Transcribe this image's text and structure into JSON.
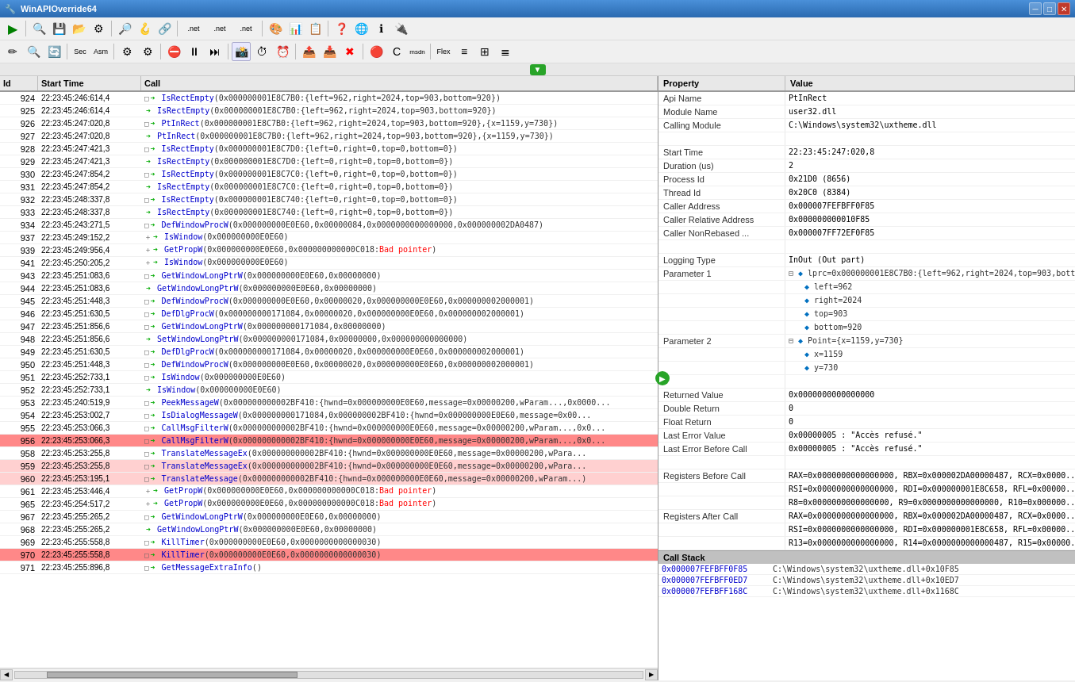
{
  "titleBar": {
    "title": "WinAPIOverride64",
    "minimize": "─",
    "maximize": "□",
    "close": "✕"
  },
  "header": {
    "property": "Property",
    "value": "Value"
  },
  "properties": {
    "apiName": {
      "label": "Api Name",
      "value": "PtInRect"
    },
    "moduleName": {
      "label": "Module Name",
      "value": "user32.dll"
    },
    "callingModule": {
      "label": "Calling Module",
      "value": "C:\\Windows\\system32\\uxtheme.dll"
    },
    "startTime": {
      "label": "Start Time",
      "value": "22:23:45:247:020,8"
    },
    "duration": {
      "label": "Duration (us)",
      "value": "2"
    },
    "processId": {
      "label": "Process Id",
      "value": "0x21D0 (8656)"
    },
    "threadId": {
      "label": "Thread Id",
      "value": "0x20C0 (8384)"
    },
    "callerAddress": {
      "label": "Caller Address",
      "value": "0x000007FEFBFF0F85"
    },
    "callerRelativeAddress": {
      "label": "Caller Relative Address",
      "value": "0x000000000010F85"
    },
    "callerNonRebased": {
      "label": "Caller NonRebased ...",
      "value": "0x000007FF72EF0F85"
    },
    "loggingType": {
      "label": "Logging Type",
      "value": "InOut (Out part)"
    },
    "parameter1": {
      "label": "Parameter 1"
    },
    "parameter1Value": "lprc=0x000000001E8C7B0:{left=962,right=2024,top=903,bott...",
    "param1Children": [
      {
        "label": "left=962"
      },
      {
        "label": "right=2024"
      },
      {
        "label": "top=903"
      },
      {
        "label": "bottom=920"
      }
    ],
    "parameter2": {
      "label": "Parameter 2"
    },
    "parameter2Value": "Point={x=1159,y=730}",
    "param2Children": [
      {
        "label": "x=1159"
      },
      {
        "label": "y=730"
      }
    ],
    "returnedValue": {
      "label": "Returned Value",
      "value": "0x0000000000000000"
    },
    "doubleReturn": {
      "label": "Double Return",
      "value": "0"
    },
    "floatReturn": {
      "label": "Float Return",
      "value": "0"
    },
    "lastErrorValue": {
      "label": "Last Error Value",
      "value": "0x00000005 : \"Accès refusé.\""
    },
    "lastErrorBeforeCall": {
      "label": "Last Error Before Call",
      "value": "0x00000005 : \"Accès refusé.\""
    },
    "registersBeforeCall": {
      "label": "Registers Before Call",
      "value": "RAX=0x0000000000000000, RBX=0x000002DA00000487, RCX=0x0000..."
    },
    "registersBeforeCall2": {
      "value": "RSI=0x0000000000000000, RDI=0x000000001E8C658, RFL=0x00000..."
    },
    "registersBeforeCall3": {
      "value": "R8=0x0000000000000000, R9=0x0000000000000000, R10=0x000000..."
    },
    "registersAfterCall": {
      "label": "Registers After Call",
      "value": "RAX=0x0000000000000000, RBX=0x000002DA00000487, RCX=0x0000..."
    },
    "registersAfterCall2": {
      "value": "RSI=0x0000000000000000, RDI=0x000000001E8C658, RFL=0x00000..."
    },
    "registersAfterCall3": {
      "value": "R13=0x0000000000000000, R14=0x0000000000000487, R15=0x00000..."
    }
  },
  "callStack": {
    "header": "Call Stack",
    "items": [
      {
        "addr": "0x000007FEFBFF0F85",
        "loc": "C:\\Windows\\system32\\uxtheme.dll+0x10F85"
      },
      {
        "addr": "0x000007FEFBFF0ED7",
        "loc": "C:\\Windows\\system32\\uxtheme.dll+0x10ED7"
      },
      {
        "addr": "0x000007FEFBFF168C",
        "loc": "C:\\Windows\\system32\\uxtheme.dll+0x1168C"
      }
    ]
  },
  "logColumns": {
    "id": "Id",
    "startTime": "Start Time",
    "call": "Call"
  },
  "logRows": [
    {
      "id": "924",
      "time": "22:23:45:246:614,4",
      "indent": 4,
      "expand": "□",
      "dir": "→",
      "call": "IsRectEmpty(0x000000001E8C7B0:{left=962,right=2024,top=903,bottom=920})",
      "style": "green"
    },
    {
      "id": "925",
      "time": "22:23:45:246:614,4",
      "indent": 4,
      "expand": "",
      "dir": "→",
      "call": "IsRectEmpty(0x000000001E8C7B0:{left=962,right=2024,top=903,bottom=920})",
      "style": "green"
    },
    {
      "id": "926",
      "time": "22:23:45:247:020,8",
      "indent": 4,
      "expand": "□",
      "dir": "→",
      "call": "PtInRect(0x000000001E8C7B0:{left=962,right=2024,top=903,bottom=920},{x=1159,y=730})",
      "style": "green"
    },
    {
      "id": "927",
      "time": "22:23:45:247:020,8",
      "indent": 4,
      "expand": "",
      "dir": "→",
      "call": "PtInRect(0x000000001E8C7B0:{left=962,right=2024,top=903,bottom=920},{x=1159,y=730})",
      "style": "green"
    },
    {
      "id": "928",
      "time": "22:23:45:247:421,3",
      "indent": 4,
      "expand": "□",
      "dir": "→",
      "call": "IsRectEmpty(0x000000001E8C7D0:{left=0,right=0,top=0,bottom=0})",
      "style": "green"
    },
    {
      "id": "929",
      "time": "22:23:45:247:421,3",
      "indent": 4,
      "expand": "",
      "dir": "→",
      "call": "IsRectEmpty(0x000000001E8C7D0:{left=0,right=0,top=0,bottom=0})",
      "style": "green"
    },
    {
      "id": "930",
      "time": "22:23:45:247:854,2",
      "indent": 4,
      "expand": "□",
      "dir": "→",
      "call": "IsRectEmpty(0x000000001E8C7C0:{left=0,right=0,top=0,bottom=0})",
      "style": "green"
    },
    {
      "id": "931",
      "time": "22:23:45:247:854,2",
      "indent": 4,
      "expand": "",
      "dir": "→",
      "call": "IsRectEmpty(0x000000001E8C7C0:{left=0,right=0,top=0,bottom=0})",
      "style": "green"
    },
    {
      "id": "932",
      "time": "22:23:45:248:337,8",
      "indent": 4,
      "expand": "□",
      "dir": "→",
      "call": "IsRectEmpty(0x000000001E8C740:{left=0,right=0,top=0,bottom=0})",
      "style": "green"
    },
    {
      "id": "933",
      "time": "22:23:45:248:337,8",
      "indent": 4,
      "expand": "",
      "dir": "→",
      "call": "IsRectEmpty(0x000000001E8C740:{left=0,right=0,top=0,bottom=0})",
      "style": "green"
    },
    {
      "id": "934",
      "time": "22:23:45:243:271,5",
      "indent": 2,
      "expand": "□",
      "dir": "→",
      "call": "DefWindowProcW(0x000000000E0E60,0x00000084,0x0000000000000000,0x000000002DA0487)",
      "style": ""
    },
    {
      "id": "937",
      "time": "22:23:45:249:152,2",
      "indent": 3,
      "expand": "＋",
      "dir": "→",
      "call": "IsWindow(0x000000000E0E60)",
      "style": ""
    },
    {
      "id": "939",
      "time": "22:23:45:249:956,4",
      "indent": 3,
      "expand": "＋",
      "dir": "→",
      "call": "GetPropW(0x000000000E0E60,0x000000000000C018:Bad pointer)",
      "style": ""
    },
    {
      "id": "941",
      "time": "22:23:45:250:205,2",
      "indent": 3,
      "expand": "＋",
      "dir": "→",
      "call": "IsWindow(0x000000000E0E60)",
      "style": ""
    },
    {
      "id": "943",
      "time": "22:23:45:251:083,6",
      "indent": 3,
      "expand": "□",
      "dir": "→",
      "call": "GetWindowLongPtrW(0x000000000E0E60,0x00000000)",
      "style": ""
    },
    {
      "id": "944",
      "time": "22:23:45:251:083,6",
      "indent": 3,
      "expand": "",
      "dir": "→",
      "call": "GetWindowLongPtrW(0x000000000E0E60,0x00000000)",
      "style": ""
    },
    {
      "id": "945",
      "time": "22:23:45:251:448,3",
      "indent": 2,
      "expand": "□",
      "dir": "→",
      "call": "DefWindowProcW(0x000000000E0E60,0x00000020,0x000000000E0E60,0x000000002000001)",
      "style": ""
    },
    {
      "id": "946",
      "time": "22:23:45:251:630,5",
      "indent": 2,
      "expand": "□",
      "dir": "→",
      "call": "DefDlgProcW(0x000000000171084,0x00000020,0x000000000E0E60,0x000000002000001)",
      "style": ""
    },
    {
      "id": "947",
      "time": "22:23:45:251:856,6",
      "indent": 3,
      "expand": "□",
      "dir": "→",
      "call": "GetWindowLongPtrW(0x000000000171084,0x00000000)",
      "style": ""
    },
    {
      "id": "948",
      "time": "22:23:45:251:856,6",
      "indent": 3,
      "expand": "",
      "dir": "→",
      "call": "SetWindowLongPtrW(0x000000000171084,0x00000000,0x000000000000000)",
      "style": ""
    },
    {
      "id": "949",
      "time": "22:23:45:251:630,5",
      "indent": 2,
      "expand": "□",
      "dir": "→",
      "call": "DefDlgProcW(0x000000000171084,0x00000020,0x000000000E0E60,0x000000002000001)",
      "style": ""
    },
    {
      "id": "950",
      "time": "22:23:45:251:448,3",
      "indent": 2,
      "expand": "□",
      "dir": "→",
      "call": "DefWindowProcW(0x000000000E0E60,0x00000020,0x000000000E0E60,0x000000002000001)",
      "style": ""
    },
    {
      "id": "951",
      "time": "22:23:45:252:733,1",
      "indent": 3,
      "expand": "□",
      "dir": "→",
      "call": "IsWindow(0x000000000E0E60)",
      "style": ""
    },
    {
      "id": "952",
      "time": "22:23:45:252:733,1",
      "indent": 3,
      "expand": "",
      "dir": "→",
      "call": "IsWindow(0x000000000E0E60)",
      "style": ""
    },
    {
      "id": "953",
      "time": "22:23:45:240:519,9",
      "indent": 1,
      "expand": "□",
      "dir": "→",
      "call": "PeekMessageW(0x000000000002BF410:{hwnd=0x000000000E0E60,message=0x00000200,wParam...,0x0000...",
      "style": ""
    },
    {
      "id": "954",
      "time": "22:23:45:253:002,7",
      "indent": 2,
      "expand": "□",
      "dir": "→",
      "call": "IsDialogMessageW(0x000000000171084,0x000000002BF410:{hwnd=0x000000000E0E60,message=0x00...",
      "style": ""
    },
    {
      "id": "955",
      "time": "22:23:45:253:066,3",
      "indent": 2,
      "expand": "□",
      "dir": "→",
      "call": "CallMsgFilterW(0x000000000002BF410:{hwnd=0x000000000E0E60,message=0x00000200,wParam...,0x0...",
      "style": ""
    },
    {
      "id": "956",
      "time": "22:23:45:253:066,3",
      "indent": 2,
      "expand": "□",
      "dir": "→",
      "call": "CallMsgFilterW(0x000000000002BF410:{hwnd=0x000000000E0E60,message=0x00000200,wParam...,0x0...",
      "style": "highlight-salmon",
      "selected": true
    },
    {
      "id": "958",
      "time": "22:23:45:253:255,8",
      "indent": 2,
      "expand": "□",
      "dir": "→",
      "call": "TranslateMessageEx(0x000000000002BF410:{hwnd=0x000000000E0E60,message=0x00000200,wPara...",
      "style": ""
    },
    {
      "id": "959",
      "time": "22:23:45:253:255,8",
      "indent": 2,
      "expand": "□",
      "dir": "→",
      "call": "TranslateMessageEx(0x000000000002BF410:{hwnd=0x000000000E0E60,message=0x00000200,wPara...",
      "style": "highlight-pink"
    },
    {
      "id": "960",
      "time": "22:23:45:253:195,1",
      "indent": 2,
      "expand": "□",
      "dir": "→",
      "call": "TranslateMessage(0x000000000002BF410:{hwnd=0x000000000E0E60,message=0x00000200,wParam...)",
      "style": "highlight-pink"
    },
    {
      "id": "961",
      "time": "22:23:45:253:446,4",
      "indent": 3,
      "expand": "＋",
      "dir": "→",
      "call": "GetPropW(0x000000000E0E60,0x000000000000C018:Bad pointer)",
      "style": ""
    },
    {
      "id": "965",
      "time": "22:23:45:254:517,2",
      "indent": 3,
      "expand": "＋",
      "dir": "→",
      "call": "GetPropW(0x000000000E0E60,0x000000000000C018:Bad pointer)",
      "style": ""
    },
    {
      "id": "967",
      "time": "22:23:45:255:265,2",
      "indent": 3,
      "expand": "□",
      "dir": "→",
      "call": "GetWindowLongPtrW(0x000000000E0E60,0x00000000)",
      "style": ""
    },
    {
      "id": "968",
      "time": "22:23:45:255:265,2",
      "indent": 3,
      "expand": "",
      "dir": "→",
      "call": "GetWindowLongPtrW(0x000000000E0E60,0x00000000)",
      "style": ""
    },
    {
      "id": "969",
      "time": "22:23:45:255:558,8",
      "indent": 2,
      "expand": "□",
      "dir": "→",
      "call": "KillTimer(0x000000000E0E60,0x0000000000000030)",
      "style": ""
    },
    {
      "id": "970",
      "time": "22:23:45:255:558,8",
      "indent": 2,
      "expand": "□",
      "dir": "→",
      "call": "KillTimer(0x000000000E0E60,0x0000000000000030)",
      "style": "highlight-salmon"
    },
    {
      "id": "971",
      "time": "22:23:45:255:896,8",
      "indent": 1,
      "expand": "□",
      "dir": "→",
      "call": "GetMessageExtraInfo()",
      "style": ""
    }
  ]
}
